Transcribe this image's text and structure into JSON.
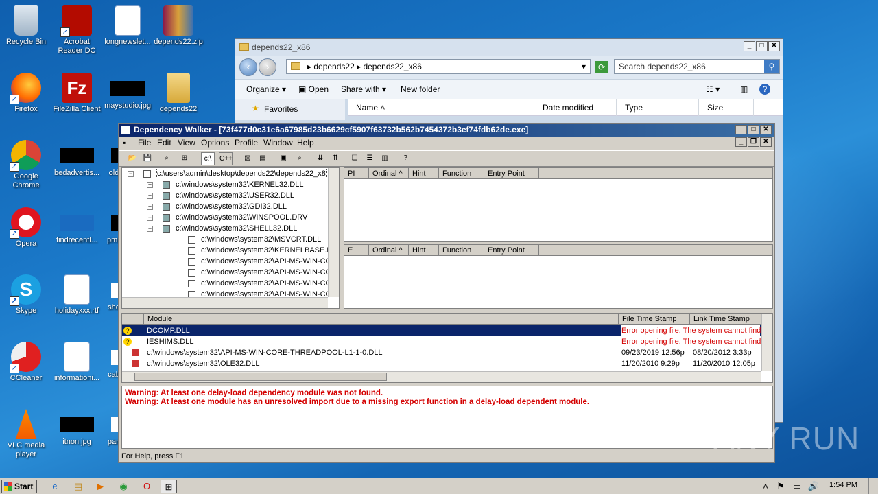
{
  "desktop": {
    "icons": [
      {
        "label": "Recycle Bin"
      },
      {
        "label": "Acrobat Reader DC"
      },
      {
        "label": "longnewslet..."
      },
      {
        "label": "depends22.zip"
      },
      {
        "label": "Firefox"
      },
      {
        "label": "FileZilla Client"
      },
      {
        "label": "maystudio.jpg"
      },
      {
        "label": "depends22"
      },
      {
        "label": "Google Chrome"
      },
      {
        "label": "bedadvertis..."
      },
      {
        "label": "old"
      },
      {
        "label": "Opera"
      },
      {
        "label": "findrecentl..."
      },
      {
        "label": "pmb"
      },
      {
        "label": "Skype"
      },
      {
        "label": "holidayxxx.rtf"
      },
      {
        "label": "sho"
      },
      {
        "label": "CCleaner"
      },
      {
        "label": "informationi..."
      },
      {
        "label": "cab"
      },
      {
        "label": "VLC media player"
      },
      {
        "label": "itnon.jpg"
      },
      {
        "label": "parl"
      }
    ]
  },
  "explorer": {
    "title": "depends22_x86",
    "breadcrumb": [
      "depends22",
      "depends22_x86"
    ],
    "search_placeholder": "Search depends22_x86",
    "commands": {
      "organize": "Organize",
      "open": "Open",
      "share": "Share with",
      "newfolder": "New folder"
    },
    "favorites": "Favorites",
    "columns": {
      "name": "Name",
      "date": "Date modified",
      "type": "Type",
      "size": "Size"
    }
  },
  "dw": {
    "title": "Dependency Walker - [73f477d0c31e6a67985d23b6629cf5907f63732b562b7454372b3ef74fdb62de.exe]",
    "menu": {
      "file": "File",
      "edit": "Edit",
      "view": "View",
      "options": "Options",
      "profile": "Profile",
      "window": "Window",
      "help": "Help"
    },
    "toolbar": {
      "c_path": "c:\\",
      "cpp": "C++"
    },
    "tree": [
      {
        "text": "c:\\users\\admin\\desktop\\depends22\\depends22_x8"
      },
      {
        "text": "c:\\windows\\system32\\KERNEL32.DLL"
      },
      {
        "text": "c:\\windows\\system32\\USER32.DLL"
      },
      {
        "text": "c:\\windows\\system32\\GDI32.DLL"
      },
      {
        "text": "c:\\windows\\system32\\WINSPOOL.DRV"
      },
      {
        "text": "c:\\windows\\system32\\SHELL32.DLL"
      },
      {
        "text": "c:\\windows\\system32\\MSVCRT.DLL"
      },
      {
        "text": "c:\\windows\\system32\\KERNELBASE.DL"
      },
      {
        "text": "c:\\windows\\system32\\API-MS-WIN-CO"
      },
      {
        "text": "c:\\windows\\system32\\API-MS-WIN-CO"
      },
      {
        "text": "c:\\windows\\system32\\API-MS-WIN-CO"
      },
      {
        "text": "c:\\windows\\system32\\API-MS-WIN-CO"
      }
    ],
    "import_cols": {
      "pi": "PI",
      "ordinal": "Ordinal ^",
      "hint": "Hint",
      "function": "Function",
      "entry": "Entry Point"
    },
    "export_cols": {
      "e": "E",
      "ordinal": "Ordinal ^",
      "hint": "Hint",
      "function": "Function",
      "entry": "Entry Point"
    },
    "module_cols": {
      "module": "Module",
      "ftime": "File Time Stamp",
      "ltime": "Link Time Stamp"
    },
    "modules": [
      {
        "name": "DCOMP.DLL",
        "ftime": "Error opening file. The system cannot find",
        "ltime": ""
      },
      {
        "name": "IESHIMS.DLL",
        "ftime": "Error opening file. The system cannot find",
        "ltime": ""
      },
      {
        "name": "c:\\windows\\system32\\API-MS-WIN-CORE-THREADPOOL-L1-1-0.DLL",
        "ftime": "09/23/2019 12:56p",
        "ltime": "08/20/2012  3:33p"
      },
      {
        "name": "c:\\windows\\system32\\OLE32.DLL",
        "ftime": "11/20/2010  9:29p",
        "ltime": "11/20/2010 12:05p"
      }
    ],
    "warnings": [
      "Warning: At least one delay-load dependency module was not found.",
      "Warning: At least one module has an unresolved import due to a missing export function in a delay-load dependent module."
    ],
    "status": "For Help, press F1"
  },
  "taskbar": {
    "start": "Start",
    "time": "1:54 PM"
  },
  "watermark": "ANY RUN"
}
